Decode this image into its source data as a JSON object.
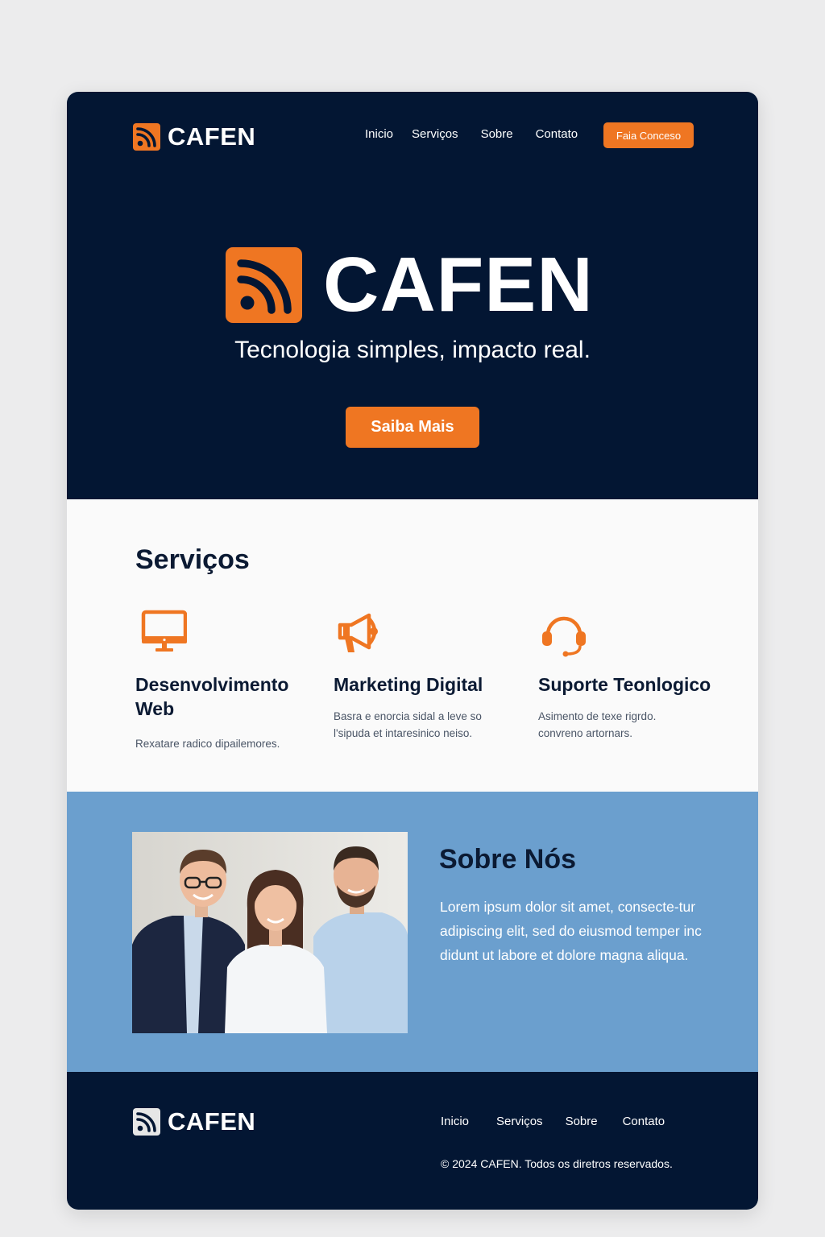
{
  "brand": {
    "name": "CAFEN",
    "accent": "#ef7622",
    "navy": "#031633",
    "about_bg": "#6b9fce"
  },
  "nav": {
    "links": [
      "Inicio",
      "Serviços",
      "Sobre",
      "Contato"
    ],
    "cta_label": "Faia Conceso"
  },
  "hero": {
    "title": "CAFEN",
    "tagline": "Tecnologia simples, impacto real.",
    "cta_label": "Saiba Mais",
    "logo_icon": "rss-icon"
  },
  "services": {
    "title": "Serviços",
    "items": [
      {
        "icon": "monitor-icon",
        "title": "Desenvolvimento Web",
        "desc": "Rexatare radico dipailemores."
      },
      {
        "icon": "megaphone-icon",
        "title": "Marketing Digital",
        "desc": "Basra e enorcia sidal a leve so l'sipuda et intaresinico neiso."
      },
      {
        "icon": "headset-icon",
        "title": "Suporte Teonlogico",
        "desc": "Asimento de texe rigrdo. convreno artornars."
      }
    ]
  },
  "about": {
    "title": "Sobre Nós",
    "text": "Lorem ipsum dolor sit amet, consecte-tur adipiscing elit, sed do eiusmod temper inc didunt ut labore et dolore magna aliqua.",
    "photo": "team-photo"
  },
  "footer": {
    "brand": "CAFEN",
    "links": [
      "Inicio",
      "Serviços",
      "Sobre",
      "Contato"
    ],
    "copyright": "© 2024 CAFEN. Todos os diretros reservados."
  }
}
